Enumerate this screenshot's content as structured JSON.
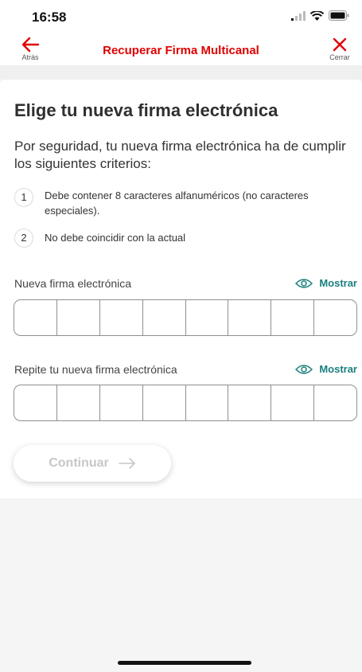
{
  "status_bar": {
    "time": "16:58"
  },
  "nav": {
    "back_label": "Atrás",
    "title": "Recuperar Firma Multicanal",
    "close_label": "Cerrar"
  },
  "content": {
    "heading": "Elige tu nueva firma electrónica",
    "intro": "Por seguridad, tu nueva firma electrónica ha de cumplir los siguientes criterios:",
    "criteria": [
      {
        "num": "1",
        "text": "Debe contener 8 caracteres alfanuméricos (no caracteres especiales)."
      },
      {
        "num": "2",
        "text": "No debe coincidir con la actual"
      }
    ]
  },
  "fields": [
    {
      "label": "Nueva firma electrónica",
      "show_label": "Mostrar"
    },
    {
      "label": "Repite tu nueva firma electrónica",
      "show_label": "Mostrar"
    }
  ],
  "continue_label": "Continuar",
  "colors": {
    "brand_red": "#e00000",
    "teal": "#1a7f7f",
    "disabled_text": "#c7c7c7"
  }
}
